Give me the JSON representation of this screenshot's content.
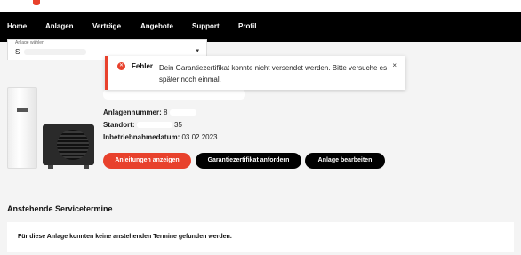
{
  "nav": {
    "items": [
      {
        "label": "Home"
      },
      {
        "label": "Anlagen"
      },
      {
        "label": "Verträge"
      },
      {
        "label": "Angebote"
      },
      {
        "label": "Support"
      },
      {
        "label": "Profil"
      }
    ],
    "active": "Anlagen"
  },
  "selector": {
    "label": "Anlage wählen",
    "value": "S"
  },
  "toast": {
    "title": "Fehler",
    "message": "Dein Garantiezertifikat konnte nicht versendet werden. Bitte versuche es später noch einmal.",
    "close": "×"
  },
  "details": {
    "anlagennummer_label": "Anlagennummer:",
    "anlagennummer_value": "8",
    "standort_label": "Standort:",
    "standort_value": "35",
    "inbetriebnahme_label": "Inbetriebnahmedatum:",
    "inbetriebnahme_value": "03.02.2023"
  },
  "buttons": {
    "anleitungen": "Anleitungen anzeigen",
    "garantie": "Garantiezertifikat anfordern",
    "bearbeiten": "Anlage bearbeiten"
  },
  "service": {
    "title": "Anstehende Servicetermine",
    "empty": "Für diese Anlage konnten keine anstehenden Termine gefunden werden."
  },
  "colors": {
    "accent": "#e8412c",
    "navbar": "#000000"
  }
}
